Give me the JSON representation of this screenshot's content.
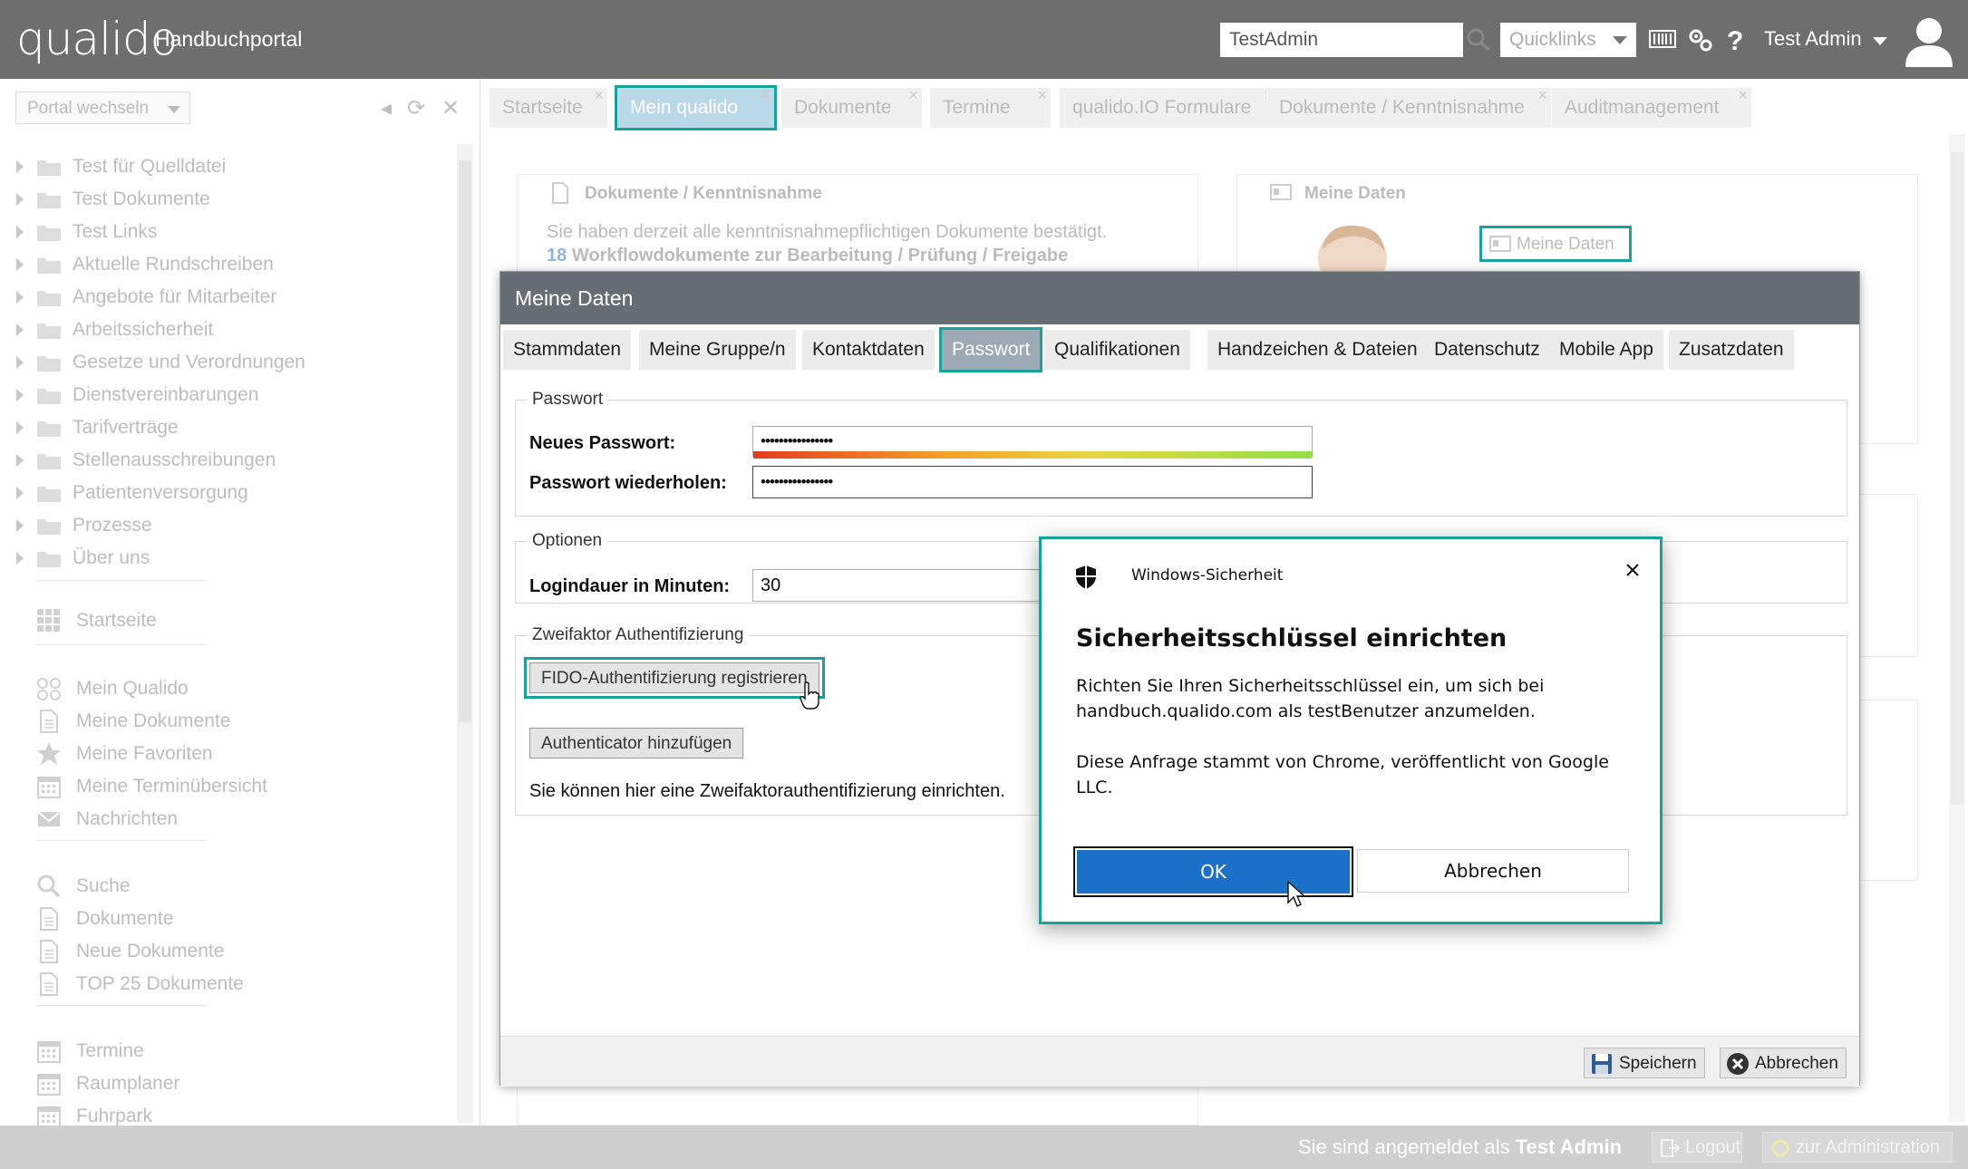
{
  "header": {
    "logo": "qualido",
    "portal_title": "Handbuchportal",
    "search_value": "TestAdmin",
    "quicklinks_label": "Quicklinks",
    "user_name": "Test Admin"
  },
  "sidebar": {
    "portal_switch_label": "Portal wechseln",
    "tree": [
      {
        "label": "Test für Quelldatei"
      },
      {
        "label": "Test Dokumente"
      },
      {
        "label": "Test Links"
      },
      {
        "label": "Aktuelle Rundschreiben"
      },
      {
        "label": "Angebote für Mitarbeiter"
      },
      {
        "label": "Arbeitssicherheit"
      },
      {
        "label": "Gesetze und Verordnungen"
      },
      {
        "label": "Dienstvereinbarungen"
      },
      {
        "label": "Tarifverträge"
      },
      {
        "label": "Stellenausschreibungen"
      },
      {
        "label": "Patientenversorgung"
      },
      {
        "label": "Prozesse"
      },
      {
        "label": "Über uns"
      }
    ],
    "nav": [
      {
        "label": "Startseite",
        "icon": "grid-icon"
      },
      {
        "label": "Mein Qualido",
        "icon": "nodes-icon"
      },
      {
        "label": "Meine Dokumente",
        "icon": "document-icon"
      },
      {
        "label": "Meine Favoriten",
        "icon": "star-icon"
      },
      {
        "label": "Meine Terminübersicht",
        "icon": "calendar-icon"
      },
      {
        "label": "Nachrichten",
        "icon": "mail-icon"
      },
      {
        "label": "Suche",
        "icon": "search-icon"
      },
      {
        "label": "Dokumente",
        "icon": "document-icon"
      },
      {
        "label": "Neue Dokumente",
        "icon": "document-icon"
      },
      {
        "label": "TOP 25 Dokumente",
        "icon": "document-icon"
      },
      {
        "label": "Termine",
        "icon": "calendar-icon"
      },
      {
        "label": "Raumplaner",
        "icon": "calendar-icon"
      },
      {
        "label": "Fuhrpark",
        "icon": "calendar-icon"
      }
    ]
  },
  "tabs": [
    {
      "label": "Startseite"
    },
    {
      "label": "Mein qualido"
    },
    {
      "label": "Dokumente"
    },
    {
      "label": "Termine"
    },
    {
      "label": "qualido.IO Formulare"
    },
    {
      "label": "Dokumente / Kenntnisnahme"
    },
    {
      "label": "Auditmanagement"
    }
  ],
  "panels": {
    "docs_title": "Dokumente / Kenntnisnahme",
    "docs_text": "Sie haben derzeit alle kenntnisnahmepflichtigen Dokumente bestätigt.",
    "docs_count": "18",
    "docs_link": "Workflowdokumente zur Bearbeitung / Prüfung / Freigabe",
    "mydata_title": "Meine Daten",
    "mydata_button": "Meine Daten"
  },
  "footer": {
    "logged_in_prefix": "Sie sind angemeldet als",
    "logged_in_user": "Test Admin",
    "logout_label": "Logout",
    "admin_label": "zur Administration"
  },
  "modal": {
    "title": "Meine Daten",
    "tabs": [
      {
        "label": "Stammdaten"
      },
      {
        "label": "Meine Gruppe/n"
      },
      {
        "label": "Kontaktdaten"
      },
      {
        "label": "Passwort"
      },
      {
        "label": "Qualifikationen"
      },
      {
        "label": "Handzeichen & Dateien"
      },
      {
        "label": "Datenschutz"
      },
      {
        "label": "Mobile App"
      },
      {
        "label": "Zusatzdaten"
      }
    ],
    "password_group": "Passwort",
    "new_password_label": "Neues Passwort:",
    "new_password_value": "••••••••••••••••",
    "repeat_password_label": "Passwort wiederholen:",
    "repeat_password_value": "••••••••••••••••",
    "options_group": "Optionen",
    "login_duration_label": "Logindauer in Minuten:",
    "login_duration_value": "30",
    "twofactor_group": "Zweifaktor Authentifizierung",
    "fido_button": "FIDO-Authentifizierung registrieren",
    "authenticator_button": "Authenticator hinzufügen",
    "twofactor_text": "Sie können hier eine Zweifaktorauthentifizierung einrichten.",
    "save_button": "Speichern",
    "cancel_button": "Abbrechen"
  },
  "winsec": {
    "app_name": "Windows-Sicherheit",
    "title": "Sicherheitsschlüssel einrichten",
    "body1": "Richten Sie Ihren Sicherheitsschlüssel ein, um sich bei handbuch.qualido.com als testBenutzer anzumelden.",
    "body2": "Diese Anfrage stammt von Chrome, veröffentlicht von Google LLC.",
    "ok_button": "OK",
    "cancel_button": "Abbrechen"
  },
  "colors": {
    "header_bg": "#6e6e6e",
    "modal_header_bg": "#676d75",
    "highlight_teal": "#16a39a",
    "ok_blue": "#1a71c7"
  }
}
